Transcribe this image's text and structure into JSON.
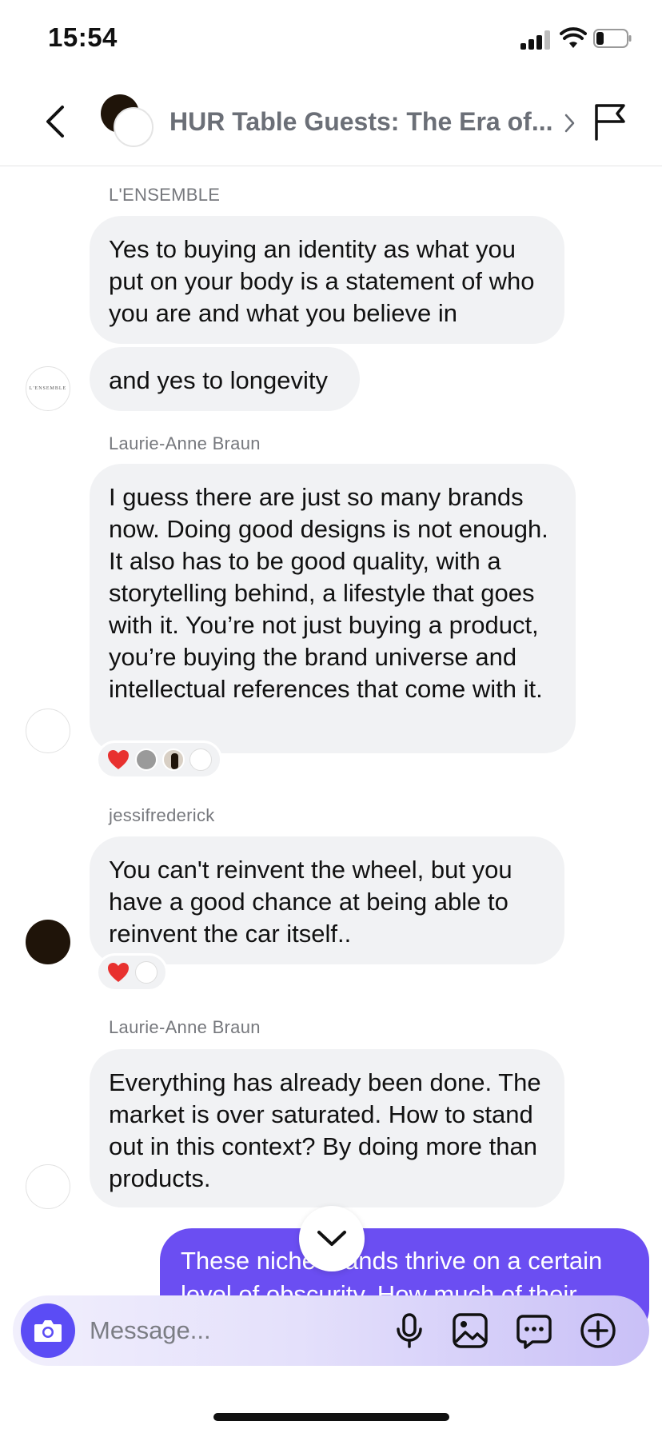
{
  "status_bar": {
    "time": "15:54",
    "battery_level": 0.2
  },
  "header": {
    "title": "HUR Table Guests: The Era of...",
    "icons": [
      "back-chevron-icon",
      "group-avatar",
      "chevron-right-icon",
      "flag-icon"
    ]
  },
  "messages": [
    {
      "sender": "L'ENSEMBLE",
      "avatar_text": "L'ENSEMBLE",
      "bubbles": [
        "Yes to buying an identity as what you put on your body is a statement of who you are and what you believe in",
        "and yes to longevity"
      ]
    },
    {
      "sender": "Laurie-Anne Braun",
      "bubbles": [
        "I guess there are just so many brands now. Doing good designs is not enough. It also has to be good quality, with a storytelling behind, a lifestyle that goes with it. You’re not just buying a product, you’re buying the brand universe and intellectual references that come with it."
      ],
      "reactions": {
        "emoji": "heart",
        "reactor_avatars": 4
      }
    },
    {
      "sender": "jessifrederick",
      "bubbles": [
        "You can't reinvent the wheel, but you have a good chance at being able to reinvent the car itself.."
      ],
      "reactions": {
        "emoji": "heart",
        "reactor_avatars": 1
      }
    },
    {
      "sender": "Laurie-Anne Braun",
      "bubbles": [
        "Everything has already been done. The market is over saturated. How to stand out in this context? By doing more than products."
      ]
    }
  ],
  "sent_message": {
    "text": "These niche brands thrive on a certain level of obscurity. How much of their"
  },
  "composer": {
    "placeholder": "Message...",
    "buttons": [
      "camera-icon",
      "microphone-icon",
      "gallery-icon",
      "sticker-icon",
      "plus-icon"
    ]
  },
  "colors": {
    "accent": "#5b4cf5",
    "sent_bubble": "#6b4ef2",
    "received_bubble": "#f1f2f4",
    "heart": "#e8312f"
  }
}
